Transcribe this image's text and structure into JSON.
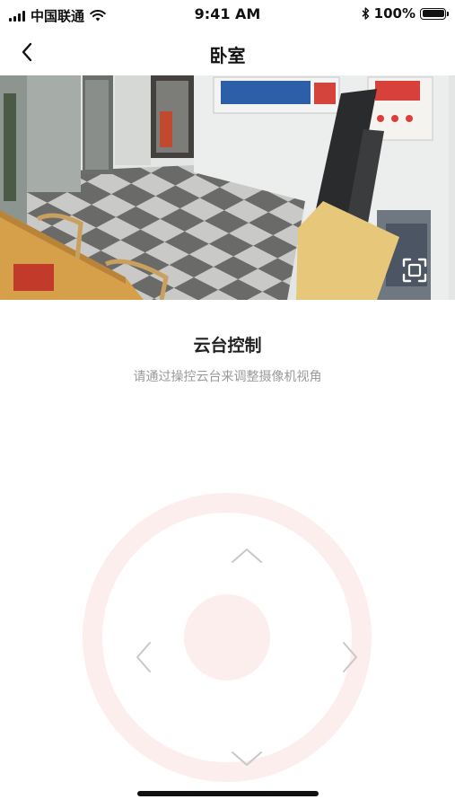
{
  "status_bar": {
    "carrier": "中国联通",
    "time": "9:41 AM",
    "battery": "100%"
  },
  "nav": {
    "title": "卧室",
    "back_icon": "chevron-left-icon"
  },
  "camera": {
    "fullscreen_icon": "fullscreen-icon"
  },
  "ptz": {
    "title": "云台控制",
    "subtitle": "请通过操控云台来调整摄像机视角",
    "icons": [
      "chevron-up-icon",
      "chevron-down-icon",
      "chevron-left-icon",
      "chevron-right-icon"
    ],
    "accent_color": "#fdeeee",
    "arrow_color": "#c8c8c8"
  }
}
